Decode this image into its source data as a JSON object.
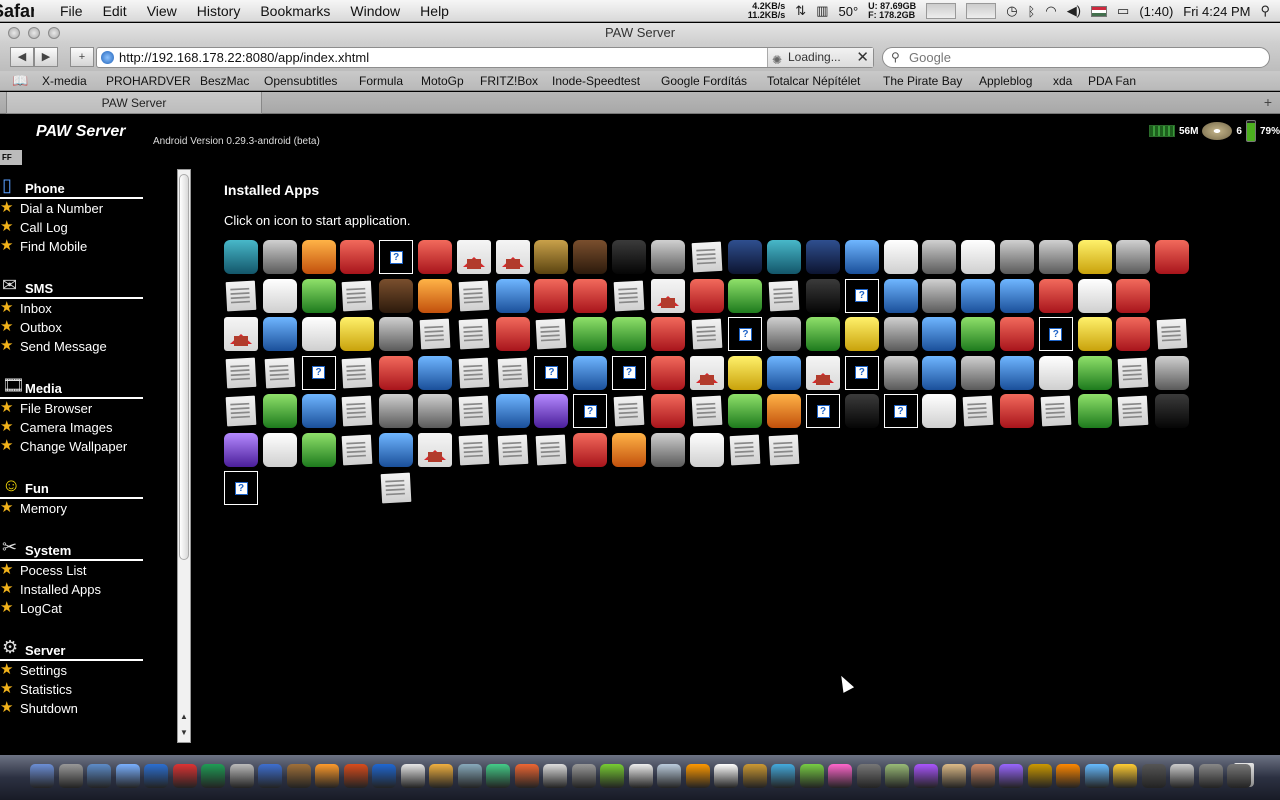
{
  "menubar": {
    "app_name": "Safari",
    "items": [
      "File",
      "Edit",
      "View",
      "History",
      "Bookmarks",
      "Window",
      "Help"
    ],
    "net_down": "4.2KB/s",
    "net_up": "11.2KB/s",
    "temperature": "50°",
    "disk_used": "U: 87.69GB",
    "disk_free": "F: 178.2GB",
    "battery": "(1:40)",
    "clock": "Fri 4:24 PM"
  },
  "window": {
    "title": "PAW Server",
    "url": "http://192.168.178.22:8080/app/index.xhtml",
    "loading_label": "Loading...",
    "search_placeholder": "Google",
    "tab_label": "PAW Server"
  },
  "bookmarks": [
    "X-media",
    "PROHARDVER",
    "BeszMac",
    "Opensubtitles",
    "Formula",
    "MotoGp",
    "FRITZ!Box",
    "Inode-Speedtest",
    "Google Fordítás",
    "Totalcar Népítélet",
    "The Pirate Bay",
    "Appleblog",
    "xda",
    "PDA Fan"
  ],
  "page": {
    "brand": "PAW Server",
    "version": "Android Version 0.29.3-android (beta)",
    "memory": "56M",
    "count": "6",
    "battery": "79%",
    "ff_badge": "FF",
    "title": "Installed Apps",
    "subtitle": "Click on icon to start application."
  },
  "sidebar": [
    {
      "title": "Phone",
      "icon": "phone-icon",
      "items": [
        "Dial a Number",
        "Call Log",
        "Find Mobile"
      ]
    },
    {
      "title": "SMS",
      "icon": "sms-icon",
      "items": [
        "Inbox",
        "Outbox",
        "Send Message"
      ]
    },
    {
      "title": "Media",
      "icon": "film-icon",
      "items": [
        "File Browser",
        "Camera Images",
        "Change Wallpaper"
      ]
    },
    {
      "title": "Fun",
      "icon": "smiley-icon",
      "items": [
        "Memory"
      ]
    },
    {
      "title": "System",
      "icon": "tools-icon",
      "items": [
        "Pocess List",
        "Installed Apps",
        "LogCat"
      ]
    },
    {
      "title": "Server",
      "icon": "gear-icon",
      "items": [
        "Settings",
        "Statistics",
        "Shutdown"
      ]
    }
  ],
  "apps": [
    [
      "compass-app-icon",
      "teal"
    ],
    [
      "gameboy-app-icon",
      "grey"
    ],
    [
      "guitar-app-icon",
      "orange"
    ],
    [
      "swiftp-app-icon",
      "red"
    ],
    [
      "unknown-app-icon",
      "q"
    ],
    [
      "robot-app-icon",
      "red"
    ],
    [
      "home-app-icon",
      "house"
    ],
    [
      "home-app-icon",
      "house"
    ],
    [
      "face-app-icon",
      "olive"
    ],
    [
      "coffee-app-icon",
      "brown"
    ],
    [
      "search-app-icon",
      "black"
    ],
    [
      "settings-app-icon",
      "grey"
    ],
    [
      "document-app-icon",
      "doc"
    ],
    [
      "laser-app-icon",
      "navy"
    ],
    [
      "play-app-icon",
      "teal"
    ],
    [
      "police-car-app-icon",
      "navy"
    ],
    [
      "alarm-clock-app-icon",
      "blue"
    ],
    [
      "photo-app-icon",
      "white"
    ],
    [
      "music-app-icon",
      "grey"
    ],
    [
      "contacts-app-icon",
      "white"
    ],
    [
      "clock-widget-app-icon",
      "grey"
    ],
    [
      "gun-app-icon",
      "grey"
    ],
    [
      "android-app-icon",
      "yellow"
    ],
    [
      "7-app-icon",
      "grey"
    ],
    [
      "mail-app-icon",
      "red"
    ],
    [
      "document-app-icon",
      "doc"
    ],
    [
      "pdf-app-icon",
      "white"
    ],
    [
      "market-app-icon",
      "green"
    ],
    [
      "document-app-icon",
      "doc"
    ],
    [
      "skull-app-icon",
      "brown"
    ],
    [
      "weather-app-icon",
      "orange"
    ],
    [
      "document-app-icon",
      "doc"
    ],
    [
      "globe-app-icon",
      "blue"
    ],
    [
      "cars-lite-app-icon",
      "red"
    ],
    [
      "barcode-app-icon",
      "red"
    ],
    [
      "sim-settings-app-icon",
      "doc"
    ],
    [
      "home-app-icon",
      "house"
    ],
    [
      "spider-app-icon",
      "red"
    ],
    [
      "bird-app-icon",
      "green"
    ],
    [
      "document-app-icon",
      "doc"
    ],
    [
      "rifle-app-icon",
      "black"
    ],
    [
      "unknown-app-icon",
      "q"
    ],
    [
      "sound-app-icon",
      "blue"
    ],
    [
      "ifight-app-icon",
      "grey"
    ],
    [
      "sphere-app-icon",
      "blue"
    ],
    [
      "gear-blue-app-icon",
      "blue"
    ],
    [
      "mail-app-icon",
      "red"
    ],
    [
      "mailbox-app-icon",
      "white"
    ],
    [
      "tools-app-icon",
      "red"
    ],
    [
      "home-app-icon",
      "house"
    ],
    [
      "c64-app-icon",
      "blue"
    ],
    [
      "mailbox-app-icon",
      "white"
    ],
    [
      "gold-app-icon",
      "yellow"
    ],
    [
      "mirror-app-icon",
      "grey"
    ],
    [
      "document-app-icon",
      "doc"
    ],
    [
      "document-app-icon",
      "doc"
    ],
    [
      "car-app-icon",
      "red"
    ],
    [
      "document-app-icon",
      "doc"
    ],
    [
      "picture-app-icon",
      "green"
    ],
    [
      "keyboard-app-icon",
      "green"
    ],
    [
      "mail-app-icon",
      "red"
    ],
    [
      "document-app-icon",
      "doc"
    ],
    [
      "unknown-app-icon",
      "q"
    ],
    [
      "ball-app-icon",
      "grey"
    ],
    [
      "wifi-app-icon",
      "green"
    ],
    [
      "sun-gear-app-icon",
      "yellow"
    ],
    [
      "keyboard-app-icon",
      "grey"
    ],
    [
      "talk-app-icon",
      "blue"
    ],
    [
      "bird-app-icon",
      "green"
    ],
    [
      "tools-app-icon",
      "red"
    ],
    [
      "unknown-app-icon",
      "q"
    ],
    [
      "pacman-app-icon",
      "yellow"
    ],
    [
      "radar-app-icon",
      "red"
    ],
    [
      "document-app-icon",
      "doc"
    ],
    [
      "document-app-icon",
      "doc"
    ],
    [
      "document-app-icon",
      "doc"
    ],
    [
      "unknown-app-icon",
      "q"
    ],
    [
      "document-app-icon",
      "doc"
    ],
    [
      "hungary-app-icon",
      "red"
    ],
    [
      "phone-app-icon",
      "blue"
    ],
    [
      "sim-settings-app-icon",
      "doc"
    ],
    [
      "document-app-icon",
      "doc"
    ],
    [
      "unknown-app-icon",
      "q"
    ],
    [
      "shazam-app-icon",
      "blue"
    ],
    [
      "unknown-app-icon",
      "q"
    ],
    [
      "no-wifi-app-icon",
      "red"
    ],
    [
      "home-app-icon",
      "house"
    ],
    [
      "card-app-icon",
      "yellow"
    ],
    [
      "globe-app-icon",
      "blue"
    ],
    [
      "home-app-icon",
      "house"
    ],
    [
      "unknown-app-icon",
      "q"
    ],
    [
      "gears-app-icon",
      "grey"
    ],
    [
      "hash-app-icon",
      "blue"
    ],
    [
      "camera-app-icon",
      "grey"
    ],
    [
      "scissors-app-icon",
      "blue"
    ],
    [
      "piano-app-icon",
      "white"
    ],
    [
      "wifi-router-app-icon",
      "green"
    ],
    [
      "document-app-icon",
      "doc"
    ],
    [
      "dial-app-icon",
      "grey"
    ],
    [
      "document-app-icon",
      "doc"
    ],
    [
      "battery-app-icon",
      "green"
    ],
    [
      "shake-app-icon",
      "blue"
    ],
    [
      "document-app-icon",
      "doc"
    ],
    [
      "music-app-icon",
      "grey"
    ],
    [
      "dial-app-icon",
      "grey"
    ],
    [
      "document-app-icon",
      "doc"
    ],
    [
      "alarm-clock-app-icon",
      "blue"
    ],
    [
      "root-app-icon",
      "purple"
    ],
    [
      "unknown-app-icon",
      "q"
    ],
    [
      "document-app-icon",
      "doc"
    ],
    [
      "microphone-app-icon",
      "red"
    ],
    [
      "document-app-icon",
      "doc"
    ],
    [
      "target-app-icon",
      "green"
    ],
    [
      "weather-app-icon",
      "orange"
    ],
    [
      "unknown-app-icon",
      "q"
    ],
    [
      "gnome-app-icon",
      "black"
    ],
    [
      "unknown-app-icon",
      "q"
    ],
    [
      "white-ball-app-icon",
      "white"
    ],
    [
      "document-app-icon",
      "doc"
    ],
    [
      "dots-app-icon",
      "red"
    ],
    [
      "document-app-icon",
      "doc"
    ],
    [
      "map-app-icon",
      "green"
    ],
    [
      "document-app-icon",
      "doc"
    ],
    [
      "magic-hat-app-icon",
      "black"
    ],
    [
      "dots-app-icon",
      "purple"
    ],
    [
      "pointer-app-icon",
      "white"
    ],
    [
      "chart-app-icon",
      "green"
    ],
    [
      "document-app-icon",
      "doc"
    ],
    [
      "maps-app-icon",
      "blue"
    ],
    [
      "home-app-icon",
      "house"
    ],
    [
      "document-app-icon",
      "doc"
    ],
    [
      "document-app-icon",
      "doc"
    ],
    [
      "sim-settings-app-icon",
      "doc"
    ],
    [
      "lifebuoy-app-icon",
      "red"
    ],
    [
      "calendar-app-icon",
      "orange"
    ],
    [
      "film-app-icon",
      "grey"
    ],
    [
      "sms-app-icon",
      "white"
    ],
    [
      "document-app-icon",
      "doc"
    ],
    [
      "document-app-icon",
      "doc"
    ],
    [
      "unknown-app-icon",
      "q"
    ],
    [
      "document-app-icon",
      "doc"
    ]
  ],
  "colors": {
    "accent_star": "#f1b21a",
    "page_bg": "#000000",
    "text": "#ffffff"
  }
}
